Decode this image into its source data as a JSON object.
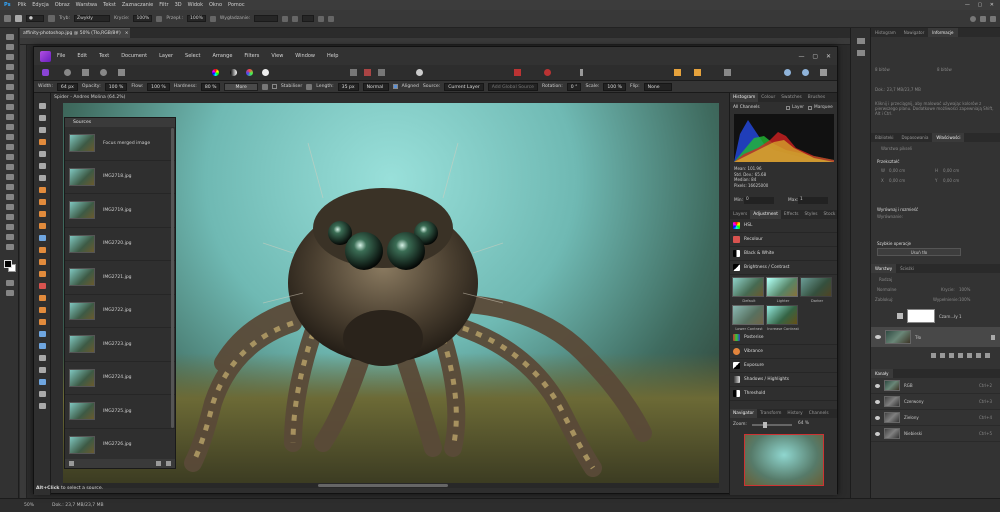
{
  "ps": {
    "menu": [
      "Plik",
      "Edycja",
      "Obraz",
      "Warstwa",
      "Tekst",
      "Zaznaczanie",
      "Filtr",
      "3D",
      "Widok",
      "Okno",
      "Pomoc"
    ],
    "options": {
      "tryb_label": "Tryb:",
      "tryb_value": "Zwykły",
      "krycie_label": "Krycie:",
      "krycie_value": "100%",
      "przeplyw_label": "Przepł.:",
      "przeplyw_value": "100%",
      "wygladzanie_label": "Wygładzanie:"
    },
    "doc_tab": "affinity-photoshop.jpg @ 50% (Tło,RGB/8#)",
    "status": {
      "zoom": "50%",
      "doc": "Dok.: 23,7 MB/23,7 MB"
    },
    "right": {
      "top_tabs": [
        "Histogram",
        "Nawigator",
        "Informacje"
      ],
      "info_rows": [
        "8 bitów",
        "8 bitów",
        "Dok.: 23,7 MB/23,7 MB"
      ],
      "info_desc": "Kliknij i przeciągnij, aby malować używając kolorów z pierwszego planu. Dodatkowe możliwości zapewniają Shift, Alt i Ctrl.",
      "props_tabs": [
        "Biblioteki",
        "Dopasowania",
        "Właściwości"
      ],
      "props_doc": "Warstwa pikseli",
      "przeksztalc": "Przekształć",
      "props_w": "W",
      "props_w_value": "0,00 cm",
      "props_h": "H",
      "props_h_value": "0,00 cm",
      "props_x": "X",
      "props_x_value": "0,00 cm",
      "props_y": "Y",
      "props_y_value": "0,00 cm",
      "wyrownaj": "Wyrównaj i rozmieść",
      "wyrownanie": "Wyrównanie:",
      "szybkie": "Szybkie operacje",
      "usun_tlo": "Usuń tło",
      "layers_tabs": [
        "Warstwy",
        "Ścieżki"
      ],
      "rodzaj": "Rodzaj",
      "zwykly": "Normalne",
      "krycie": "Krycie:",
      "krycie_val": "100%",
      "zablokuj": "Zablokuj:",
      "wypelnienie": "Wypełnienie:",
      "wyp_val": "100%",
      "layers": [
        {
          "name": "Czarn...ły 1"
        },
        {
          "name": "Tło"
        }
      ],
      "kanaly_title": "Kanały",
      "channels": [
        {
          "name": "RGB",
          "key": "Ctrl+2"
        },
        {
          "name": "Czerwony",
          "key": "Ctrl+3"
        },
        {
          "name": "Zielony",
          "key": "Ctrl+4"
        },
        {
          "name": "Niebieski",
          "key": "Ctrl+5"
        }
      ]
    }
  },
  "af": {
    "menu": [
      "File",
      "Edit",
      "Text",
      "Document",
      "Layer",
      "Select",
      "Arrange",
      "Filters",
      "View",
      "Window",
      "Help"
    ],
    "ctx": {
      "width_label": "Width:",
      "width_value": "64 px",
      "opacity_label": "Opacity:",
      "opacity_value": "100 %",
      "flow_label": "Flow:",
      "flow_value": "100 %",
      "hardness_label": "Hardness:",
      "hardness_value": "80 %",
      "more": "More",
      "stabiliser": "Stabiliser",
      "length_label": "Length:",
      "length_value": "35 px",
      "mode_value": "Normal",
      "aligned": "Aligned",
      "source_label": "Source:",
      "source_value": "Current Layer",
      "add_global": "Add Global Source",
      "rotation_label": "Rotation:",
      "rotation_value": "0 °",
      "scale_label": "Scale:",
      "scale_value": "100 %",
      "flip_label": "Flip:",
      "flip_value": "None"
    },
    "doc_title": "Spider - Andres Molina (64.2%)",
    "sources": {
      "title": "Sources",
      "items": [
        "Focus merged image",
        "IMG2718.jpg",
        "IMG2719.jpg",
        "IMG2720.jpg",
        "IMG2721.jpg",
        "IMG2722.jpg",
        "IMG2723.jpg",
        "IMG2724.jpg",
        "IMG2725.jpg",
        "IMG2726.jpg"
      ]
    },
    "hint_bold": "Alt+Click",
    "hint_text": "to select a source.",
    "right": {
      "hist_tabs": [
        "Histogram",
        "Colour",
        "Swatches",
        "Brushes"
      ],
      "channels": "All Channels",
      "layer_opt": "Layer",
      "marquee_opt": "Marquee",
      "stats": [
        "Mean: 101.96",
        "Std. Dev.: 65.68",
        "Median: 84",
        "Pixels: 16625000"
      ],
      "min_label": "Min:",
      "min_value": "0",
      "max_label": "Max:",
      "max_value": "1",
      "adj_tabs": [
        "Layers",
        "Adjustment",
        "Effects",
        "Styles",
        "Stock"
      ],
      "adjustments_top": [
        "HSL",
        "Recolour",
        "Black & White",
        "Brightness / Contrast"
      ],
      "presets_row1": [
        "Default",
        "Lighter",
        "Darker"
      ],
      "presets_row2": [
        "Lower Contrast",
        "Increase Contrast"
      ],
      "adjustments_bottom": [
        "Posterise",
        "Vibrance",
        "Exposure",
        "Shadows / Highlights",
        "Threshold"
      ],
      "nav_tabs": [
        "Navigator",
        "Transform",
        "History",
        "Channels"
      ],
      "zoom_label": "Zoom:",
      "zoom_value": "64 %"
    }
  }
}
